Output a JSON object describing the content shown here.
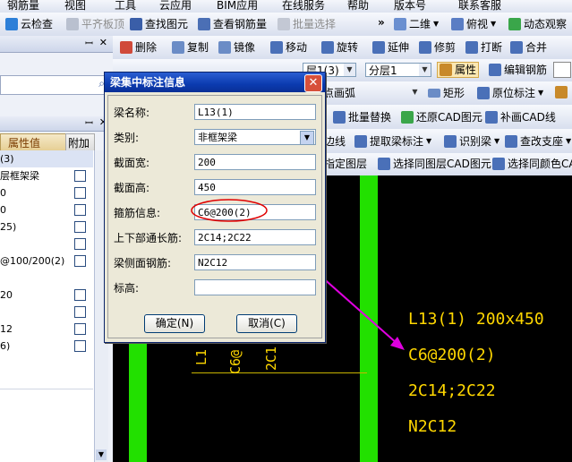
{
  "menu": [
    "钢筋量",
    "视图",
    "工具",
    "云应用",
    "BIM应用",
    "在线服务",
    "帮助",
    "版本号",
    "联系客服"
  ],
  "toolbar1": {
    "cloud_check": "云检查",
    "level_board": "平齐板顶",
    "find_element": "查找图元",
    "view_rebar": "查看钢筋量",
    "batch_select": "批量选择",
    "two_d": "二维",
    "view_mode": "俯视",
    "dynamic_view": "动态观察",
    "more": "»"
  },
  "toolbar2": {
    "delete": "删除",
    "copy": "复制",
    "mirror": "镜像",
    "move": "移动",
    "rotate": "旋转",
    "extend": "延伸",
    "trim": "修剪",
    "break": "打断",
    "merge": "合并"
  },
  "toolbar3": {
    "layer_combo": "层1(3)",
    "floor": "分层1",
    "properties": "属性",
    "edit_rebar": "编辑钢筋"
  },
  "toolbar4": {
    "arc_combo": "点画弧",
    "rect": "矩形",
    "origin_label": "原位标注"
  },
  "toolbar5": {
    "batch_replace": "批量替换",
    "restore_cad": "还原CAD图元",
    "patch_cad": "补画CAD线"
  },
  "toolbar6": {
    "edge": "边线",
    "extract_beam_label": "提取梁标注",
    "identify_beam": "识别梁",
    "check_support": "查改支座"
  },
  "toolbar7": {
    "assign_layer": "指定图层",
    "select_same_layer": "选择同图层CAD图元",
    "select_same_color": "选择同颜色CAD"
  },
  "left_panel": {
    "col_value": "属性值",
    "col_attach": "附加",
    "rows": [
      "(3)",
      "层框架梁",
      "0",
      "0",
      "25)",
      "",
      "@100/200(2)",
      "",
      "20",
      "",
      "12",
      "6)",
      "",
      ""
    ]
  },
  "dialog": {
    "title": "梁集中标注信息",
    "close": "✕",
    "fields": [
      {
        "label": "梁名称:",
        "value": "L13(1)",
        "type": "text"
      },
      {
        "label": "类别:",
        "value": "非框架梁",
        "type": "select"
      },
      {
        "label": "截面宽:",
        "value": "200",
        "type": "text"
      },
      {
        "label": "截面高:",
        "value": "450",
        "type": "text"
      },
      {
        "label": "箍筋信息:",
        "value": "C6@200(2)",
        "type": "text"
      },
      {
        "label": "上下部通长筋:",
        "value": "2C14;2C22",
        "type": "text"
      },
      {
        "label": "梁侧面钢筋:",
        "value": "N2C12",
        "type": "text"
      },
      {
        "label": "标高:",
        "value": "",
        "type": "text"
      }
    ],
    "ok": "确定(N)",
    "cancel": "取消(C)"
  },
  "cad": {
    "annotation": [
      "L13(1)  200x450",
      "C6@200(2)",
      "2C14;2C22",
      "N2C12"
    ],
    "vertical": [
      "L1",
      "C6@",
      "2C1"
    ]
  },
  "colors": {
    "beam_green": "#22e000",
    "cad_text": "#ffd700",
    "arrow": "#e000e0",
    "callout_red": "#e00000",
    "dialog_title": "#0b3bb0"
  }
}
